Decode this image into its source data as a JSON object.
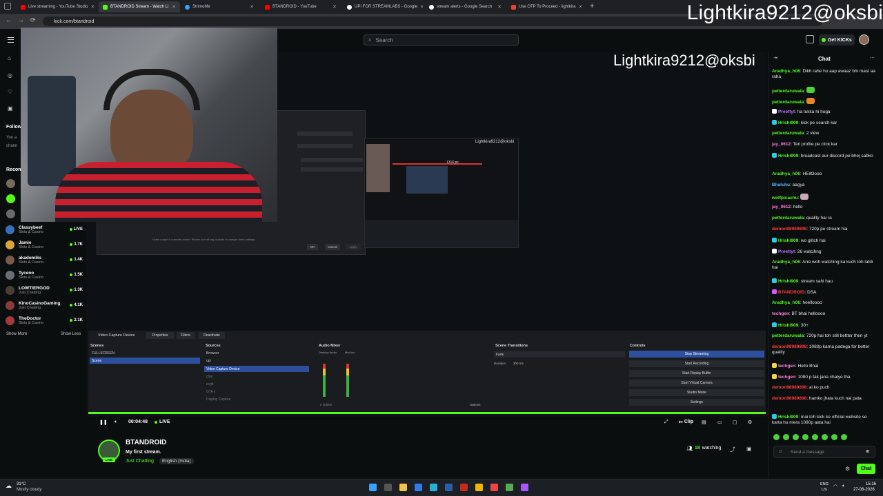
{
  "browser": {
    "tabs": [
      {
        "label": "Live streaming - YouTube Studio",
        "color": "#ff0000"
      },
      {
        "label": "BTANDROID Stream - Watch Li",
        "color": "#53fc18"
      },
      {
        "label": "StrimoMe",
        "color": "#3aa0ff"
      },
      {
        "label": "BTANDROID - YouTube",
        "color": "#ff0000"
      },
      {
        "label": "UPI FOR STREAMLABS - Google",
        "color": "#ffffff"
      },
      {
        "label": "stream alerts - Google Search",
        "color": "#ffffff"
      },
      {
        "label": "Use OTP To Proceed - lightkira",
        "color": "#ea4335"
      }
    ],
    "new_tab": "+",
    "url": "kick.com/btandroid"
  },
  "watermark": "Lightkira9212@oksbi",
  "header": {
    "search_placeholder": "Search",
    "get_kicks": "Get KICKs"
  },
  "sidebar": {
    "following": "Follow",
    "following_hint_1": "You a",
    "following_hint_2": "chann",
    "recommended": "Recon",
    "channels": [
      {
        "name": "Classybeef",
        "category": "Slots & Casino",
        "count": "LIVE",
        "color": "#3b6fb5"
      },
      {
        "name": "Jamie",
        "category": "Slots & Casino",
        "count": "1.7K",
        "color": "#d9a43a"
      },
      {
        "name": "akademiks",
        "category": "Slots & Casino",
        "count": "1.4K",
        "color": "#7a5a48"
      },
      {
        "name": "Tyceno",
        "category": "Slots & Casino",
        "count": "1.5K",
        "color": "#6a6f77"
      },
      {
        "name": "LOWTIERGOD",
        "category": "Just Chatting",
        "count": "1.3K",
        "color": "#4a3d35"
      },
      {
        "name": "KinoCasinoGaming",
        "category": "Just Chatting",
        "count": "4.1K",
        "color": "#8a3a3a"
      },
      {
        "name": "TheDoctor",
        "category": "Slots & Casino",
        "count": "2.1K",
        "color": "#a23a3a"
      }
    ],
    "show_more": "Show More",
    "show_less": "Show Less"
  },
  "video": {
    "overlay_text": "Lightkira9212@oksbi",
    "dialog_note": "Video output is currently active. Please turn off any outputs to change video settings.",
    "dialog_ok": "OK",
    "dialog_cancel": "Cancel",
    "dialog_apply": "Apply",
    "inner_label": "Lightkira9212@oksbi",
    "inner_px": "1316 px",
    "obs": {
      "source_title": "Video Capture Device",
      "properties": "Properties",
      "filters": "Filters",
      "deactivate": "Deactivate",
      "scenes_header": "Scenes",
      "scenes": [
        "FULLSCREEN",
        "Scene"
      ],
      "sources_header": "Sources",
      "sources": [
        "Browser",
        "upi",
        "Video Capture Device",
        "chat",
        "ccgb",
        "GTA v",
        "Display Capture"
      ],
      "mixer_header": "Audio Mixer",
      "mixer_channels": [
        "Desktop Audio",
        "Mic/Aux"
      ],
      "hidden": "0 hidden",
      "options": "Options",
      "transitions_header": "Scene Transitions",
      "transition": "Fade",
      "duration_label": "Duration",
      "duration_value": "300 ms",
      "controls_header": "Controls",
      "controls": [
        "Stop Streaming",
        "Start Recording",
        "Start Replay Buffer",
        "Start Virtual Camera",
        "Studio Mode",
        "Settings"
      ]
    }
  },
  "player": {
    "time": "00:04:48",
    "live": "LIVE",
    "clip": "Clip"
  },
  "stream": {
    "streamer": "BTANDROID",
    "title": "My first stream.",
    "category": "Just Chatting",
    "language": "English (India)",
    "watching_count": "18",
    "watching_label": "watching",
    "live_badge": "LIVE"
  },
  "chat": {
    "title": "Chat",
    "messages": [
      {
        "user": "Aradhya_h06",
        "text": "Dikh rahe ho aap awaaz bhi mast aa raha",
        "color": "#53fc18",
        "badge": ""
      },
      {
        "user": "petterdaruwala",
        "text": "",
        "color": "#53fc18",
        "badge": "",
        "emote": "#4bd13a"
      },
      {
        "user": "petterdaruwala",
        "text": "",
        "color": "#53fc18",
        "badge": "",
        "emote": "#e9862a"
      },
      {
        "user": "Preettyt",
        "text": "ha tukka hi hoga",
        "color": "#c36bff",
        "badge": "#ffffff"
      },
      {
        "user": "Hrishi909",
        "text": "kick pe search kar",
        "color": "#53fc18",
        "badge": "#2ec9e0"
      },
      {
        "user": "petterdaruwala",
        "text": "2 view",
        "color": "#53fc18",
        "badge": ""
      },
      {
        "user": "jay_0612",
        "text": "Teri profile pe click kar",
        "color": "#ff7adf",
        "badge": ""
      },
      {
        "user": "Hrishi909",
        "text": "broadcast aur discord pe bhej sabko",
        "color": "#53fc18",
        "badge": "#2ec9e0"
      },
      {
        "user": "Aradhya_h06",
        "text": "HEllOooo",
        "color": "#53fc18",
        "badge": ""
      },
      {
        "user": "Bhaluhu",
        "text": "aagya",
        "color": "#56b4ff",
        "badge": ""
      },
      {
        "user": "wolfpicachu",
        "text": "",
        "color": "#53fc18",
        "badge": "",
        "emote": "#c9a9b8"
      },
      {
        "user": "jay_0612",
        "text": "hello",
        "color": "#ff7adf",
        "badge": ""
      },
      {
        "user": "petterdaruwala",
        "text": "quality hai ra",
        "color": "#53fc18",
        "badge": ""
      },
      {
        "user": "demon98989898",
        "text": "720p pe stream hai",
        "color": "#ff3b3b",
        "badge": ""
      },
      {
        "user": "Hrishi909",
        "text": "wo glitch hai",
        "color": "#53fc18",
        "badge": "#2ec9e0"
      },
      {
        "user": "Preettyt",
        "text": "26 watcihng",
        "color": "#c36bff",
        "badge": "#ffffff"
      },
      {
        "user": "Aradhya_h06",
        "text": "Arre woh watching ka kuch toh lafdi hai",
        "color": "#53fc18",
        "badge": ""
      },
      {
        "user": "Hrishi909",
        "text": "stream sahi hau",
        "color": "#53fc18",
        "badge": "#2ec9e0"
      },
      {
        "user": "BTANDROID",
        "text": "DSA",
        "color": "#ff3b3b",
        "badge": "#e54dff"
      },
      {
        "user": "Aradhya_h06",
        "text": "heelloooo",
        "color": "#53fc18",
        "badge": ""
      },
      {
        "user": "techgen",
        "text": "BT bhai helloooo",
        "color": "#ff7adf",
        "badge": ""
      },
      {
        "user": "Hrishi909",
        "text": "30+",
        "color": "#53fc18",
        "badge": "#2ec9e0"
      },
      {
        "user": "petterdaruwala",
        "text": "720p hai toh still bettter then yt",
        "color": "#53fc18",
        "badge": ""
      },
      {
        "user": "demon98989898",
        "text": "1080p karna padega for better quality",
        "color": "#ff3b3b",
        "badge": ""
      },
      {
        "user": "techgen",
        "text": "Hello Bhai",
        "color": "#ff7adf",
        "badge": "#f5d442"
      },
      {
        "user": "techgen",
        "text": "1080 p tak jana chalye tha",
        "color": "#ff7adf",
        "badge": "#f5d442"
      },
      {
        "user": "demon98989898",
        "text": "ai ko puch",
        "color": "#ff3b3b",
        "badge": ""
      },
      {
        "user": "demon98989898",
        "text": "hamko jhata kuch nai pata",
        "color": "#ff3b3b",
        "badge": ""
      },
      {
        "user": "Hrishi909",
        "text": "mai toh kick ke official website se karta hu mera 1080p aata hai",
        "color": "#53fc18",
        "badge": "#2ec9e0"
      }
    ],
    "input_placeholder": "Send a message",
    "send_button": "Chat"
  },
  "taskbar": {
    "temp": "31°C",
    "weather": "Mostly cloudy",
    "lang_top": "ENG",
    "lang_bottom": "US",
    "time": "15:16",
    "date": "27-08-2026"
  },
  "colors": {
    "accent": "#53fc18",
    "background": "#0b0e0f"
  }
}
